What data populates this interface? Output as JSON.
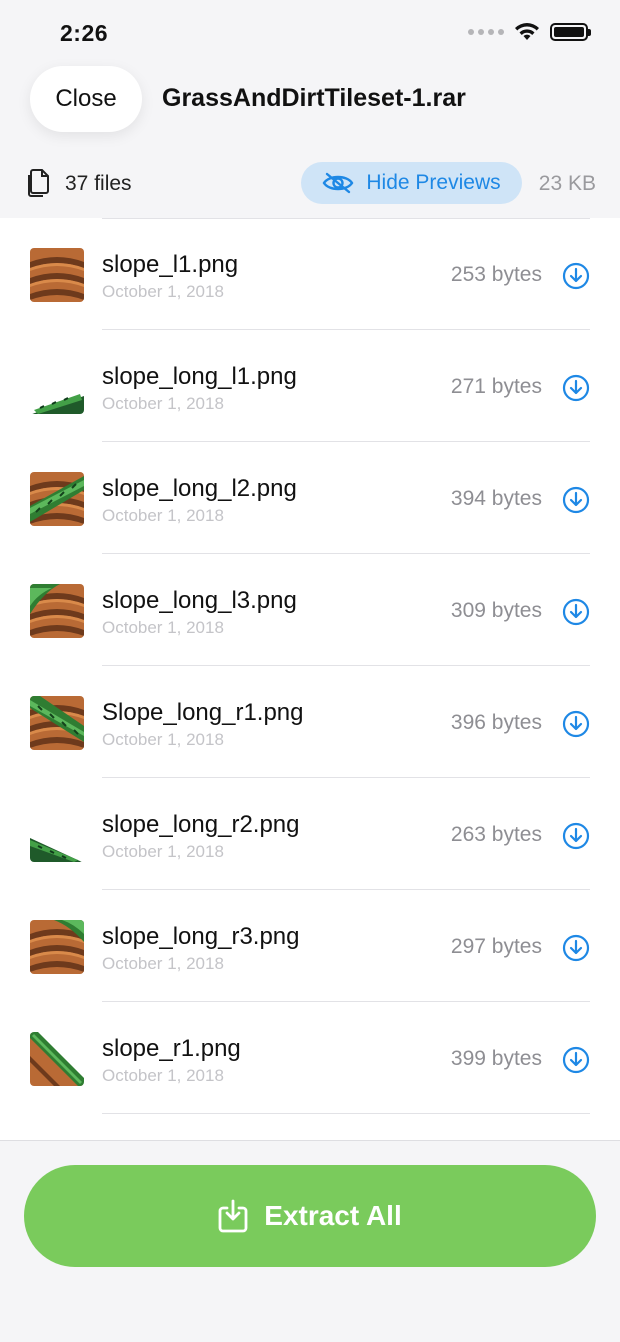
{
  "status_bar": {
    "time": "2:26"
  },
  "header": {
    "close_label": "Close",
    "title": "GrassAndDirtTileset-1.rar"
  },
  "meta": {
    "files_count": "37 files",
    "hide_previews_label": "Hide Previews",
    "total_size": "23 KB"
  },
  "files": [
    {
      "name": "slope_l1.png",
      "date": "October 1, 2018",
      "size": "253 bytes",
      "preview": "full-dirt"
    },
    {
      "name": "slope_long_l1.png",
      "date": "October 1, 2018",
      "size": "271 bytes",
      "preview": "thin-grass-left"
    },
    {
      "name": "slope_long_l2.png",
      "date": "October 1, 2018",
      "size": "394 bytes",
      "preview": "grass-slope-left"
    },
    {
      "name": "slope_long_l3.png",
      "date": "October 1, 2018",
      "size": "309 bytes",
      "preview": "grass-corner-left"
    },
    {
      "name": "Slope_long_r1.png",
      "date": "October 1, 2018",
      "size": "396 bytes",
      "preview": "grass-slope-right"
    },
    {
      "name": "slope_long_r2.png",
      "date": "October 1, 2018",
      "size": "263 bytes",
      "preview": "thin-grass-right"
    },
    {
      "name": "slope_long_r3.png",
      "date": "October 1, 2018",
      "size": "297 bytes",
      "preview": "grass-top-dirt"
    },
    {
      "name": "slope_r1.png",
      "date": "October 1, 2018",
      "size": "399 bytes",
      "preview": "steep-right"
    }
  ],
  "footer": {
    "extract_label": "Extract All"
  },
  "colors": {
    "accent_blue": "#1e88e5",
    "extract_green": "#7acb5c",
    "pill_blue": "#cfe4f7"
  }
}
